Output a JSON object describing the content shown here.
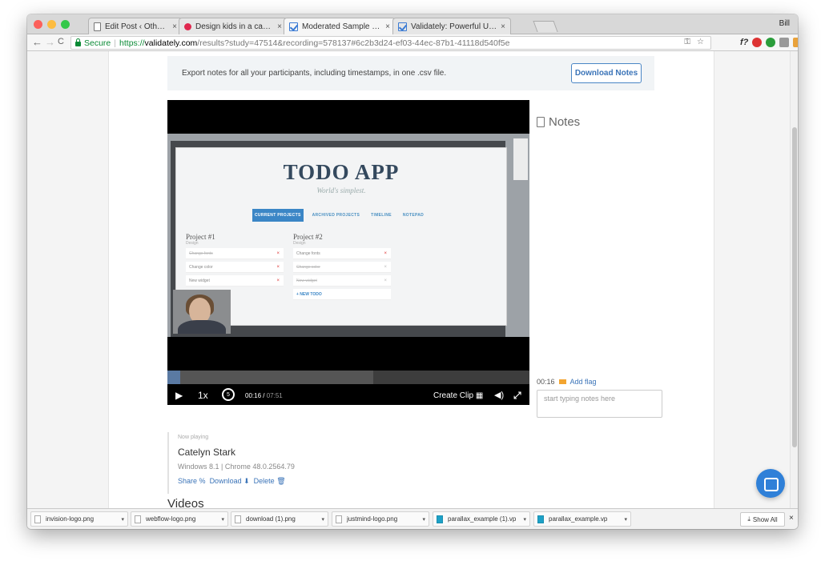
{
  "browser": {
    "user": "Bill",
    "tabs": [
      {
        "title": "Edit Post ‹ Other Media — Wo",
        "icon": "document-icon"
      },
      {
        "title": "Design kids in a candy shop | ",
        "icon": "dribbble-icon"
      },
      {
        "title": "Moderated Sample - Validately",
        "icon": "validately-icon",
        "active": true
      },
      {
        "title": "Validately: Powerful User Rese",
        "icon": "validately-icon"
      }
    ],
    "address": {
      "secure_label": "Secure",
      "scheme": "https://",
      "host": "validately.com",
      "path": "/results?study=47514&recording=578137#6c2b3d24-ef03-44ec-87b1-41118d540f5e"
    }
  },
  "export_bar": {
    "text": "Export notes for all your participants, including timestamps, in one .csv file.",
    "button": "Download Notes"
  },
  "video": {
    "app_title": "TODO APP",
    "app_subtitle": "World's simplest.",
    "app_tabs": [
      "CURRENT PROJECTS",
      "ARCHIVED PROJECTS",
      "TIMELINE",
      "NOTEPAD"
    ],
    "projects": [
      {
        "name": "Project #1",
        "sub": "Design",
        "items": [
          "Change fonts",
          "Change color",
          "New widget"
        ]
      },
      {
        "name": "Project #2",
        "sub": "Design",
        "items": [
          "Change fonts",
          "Change color",
          "New widget"
        ],
        "add": "+ NEW TODO"
      }
    ],
    "progress": 0.035,
    "speed": "1x",
    "current_time": "00:16",
    "duration": "07:51",
    "create_clip": "Create Clip"
  },
  "notes": {
    "title": "Notes",
    "timestamp": "00:16",
    "add_flag": "Add flag",
    "placeholder": "start typing notes here"
  },
  "now_playing": {
    "label": "Now playing",
    "name": "Catelyn Stark",
    "system": "Windows 8.1 | Chrome 48.0.2564.79",
    "share": "Share",
    "download": "Download",
    "delete": "Delete"
  },
  "videos_heading": "Videos",
  "downloads": [
    {
      "name": "invision-logo.png",
      "type": "png"
    },
    {
      "name": "webflow-logo.png",
      "type": "png"
    },
    {
      "name": "download (1).png",
      "type": "png"
    },
    {
      "name": "justmind-logo.png",
      "type": "png"
    },
    {
      "name": "parallax_example (1).vp",
      "type": "vp"
    },
    {
      "name": "parallax_example.vp",
      "type": "vp"
    }
  ],
  "show_all": "Show All"
}
